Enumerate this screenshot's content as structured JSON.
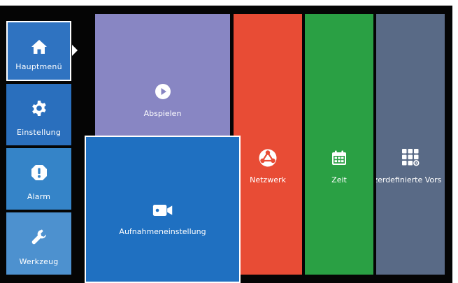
{
  "sidebar": {
    "items": [
      {
        "label": "Hauptmenü",
        "icon": "home-icon",
        "selected": true
      },
      {
        "label": "Einstellung",
        "icon": "gear-icon"
      },
      {
        "label": "Alarm",
        "icon": "alert-icon"
      },
      {
        "label": "Werkzeug",
        "icon": "wrench-icon"
      }
    ]
  },
  "tiles": {
    "playback": {
      "label": "Abspielen",
      "icon": "play-icon"
    },
    "network": {
      "label": "Netzwerk",
      "icon": "network-icon"
    },
    "time": {
      "label": "Zeit",
      "icon": "calendar-icon"
    },
    "custom": {
      "label": "Benutzerdefinierte Vorsc",
      "visible_text": "tzerdefinierte Vors",
      "icon": "grid-settings-icon"
    },
    "recording": {
      "label": "Aufnahmeneinstellung",
      "icon": "camera-icon"
    }
  },
  "colors": {
    "background": "#050505",
    "sidebar_home": "#2f73c1",
    "sidebar_settings": "#2a6fbd",
    "sidebar_alarm": "#3584c8",
    "sidebar_tools": "#4d91cf",
    "playback": "#8886c3",
    "network": "#e84c35",
    "time": "#2aa044",
    "custom": "#596a86",
    "recording": "#1f70c1"
  }
}
